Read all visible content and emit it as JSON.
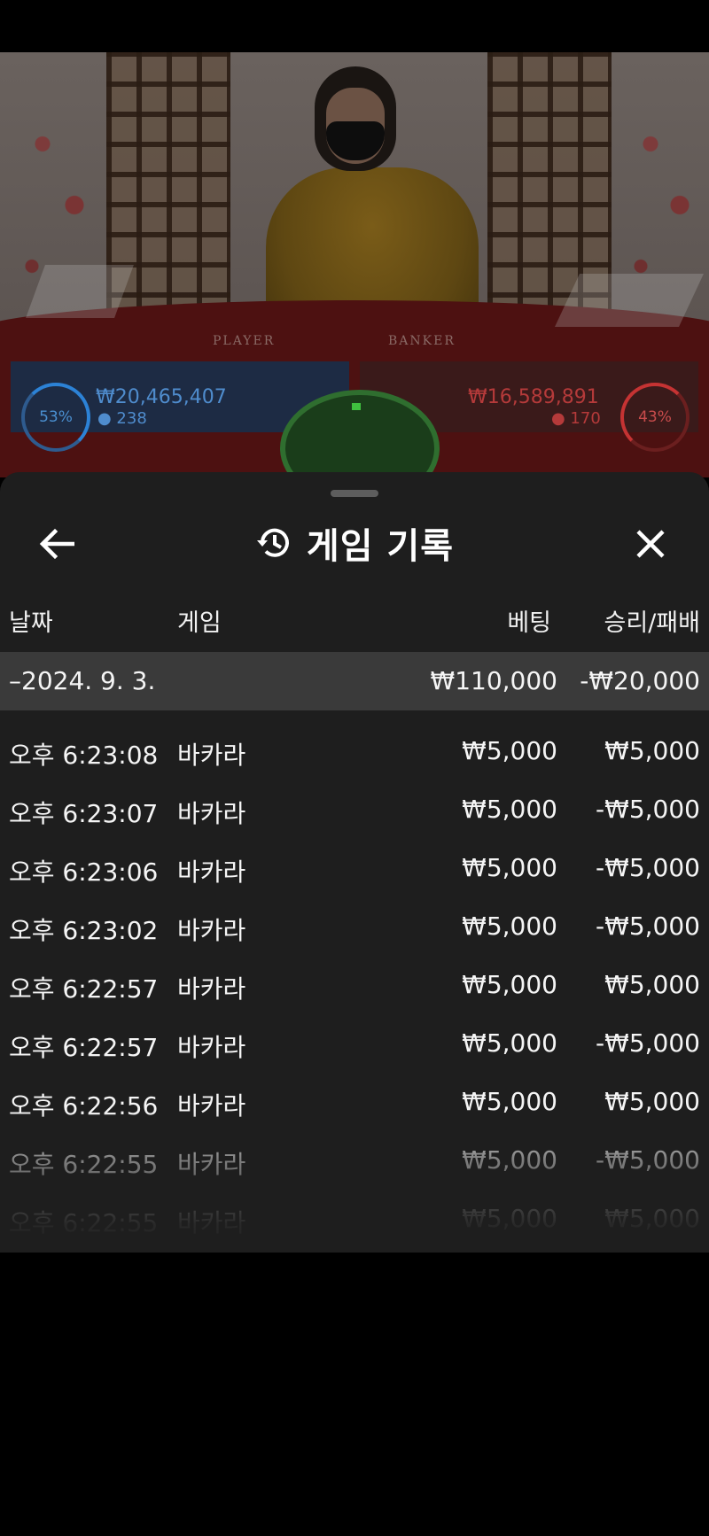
{
  "video": {
    "table_labels": {
      "player": "PLAYER",
      "banker": "BANKER"
    },
    "player_stats": {
      "percent": "53%",
      "amount": "₩20,465,407",
      "count": "● 238"
    },
    "banker_stats": {
      "percent": "43%",
      "amount": "₩16,589,891",
      "count": "● 170"
    }
  },
  "sheet": {
    "title": "게임 기록",
    "icons": {
      "back": "arrow-left-icon",
      "history": "history-icon",
      "close": "close-icon"
    },
    "columns": {
      "date": "날짜",
      "game": "게임",
      "bet": "베팅",
      "result": "승리/패배"
    },
    "date_group": {
      "date": "–2024. 9. 3.",
      "bet_total": "₩110,000",
      "result_total": "-₩20,000"
    },
    "rows": [
      {
        "time": "오후 6:23:08",
        "game": "바카라",
        "bet": "₩5,000",
        "result": "₩5,000"
      },
      {
        "time": "오후 6:23:07",
        "game": "바카라",
        "bet": "₩5,000",
        "result": "-₩5,000"
      },
      {
        "time": "오후 6:23:06",
        "game": "바카라",
        "bet": "₩5,000",
        "result": "-₩5,000"
      },
      {
        "time": "오후 6:23:02",
        "game": "바카라",
        "bet": "₩5,000",
        "result": "-₩5,000"
      },
      {
        "time": "오후 6:22:57",
        "game": "바카라",
        "bet": "₩5,000",
        "result": "₩5,000"
      },
      {
        "time": "오후 6:22:57",
        "game": "바카라",
        "bet": "₩5,000",
        "result": "-₩5,000"
      },
      {
        "time": "오후 6:22:56",
        "game": "바카라",
        "bet": "₩5,000",
        "result": "₩5,000"
      },
      {
        "time": "오후 6:22:55",
        "game": "바카라",
        "bet": "₩5,000",
        "result": "-₩5,000"
      },
      {
        "time": "오후 6:22:55",
        "game": "바카라",
        "bet": "₩5,000",
        "result": "₩5,000"
      }
    ]
  }
}
